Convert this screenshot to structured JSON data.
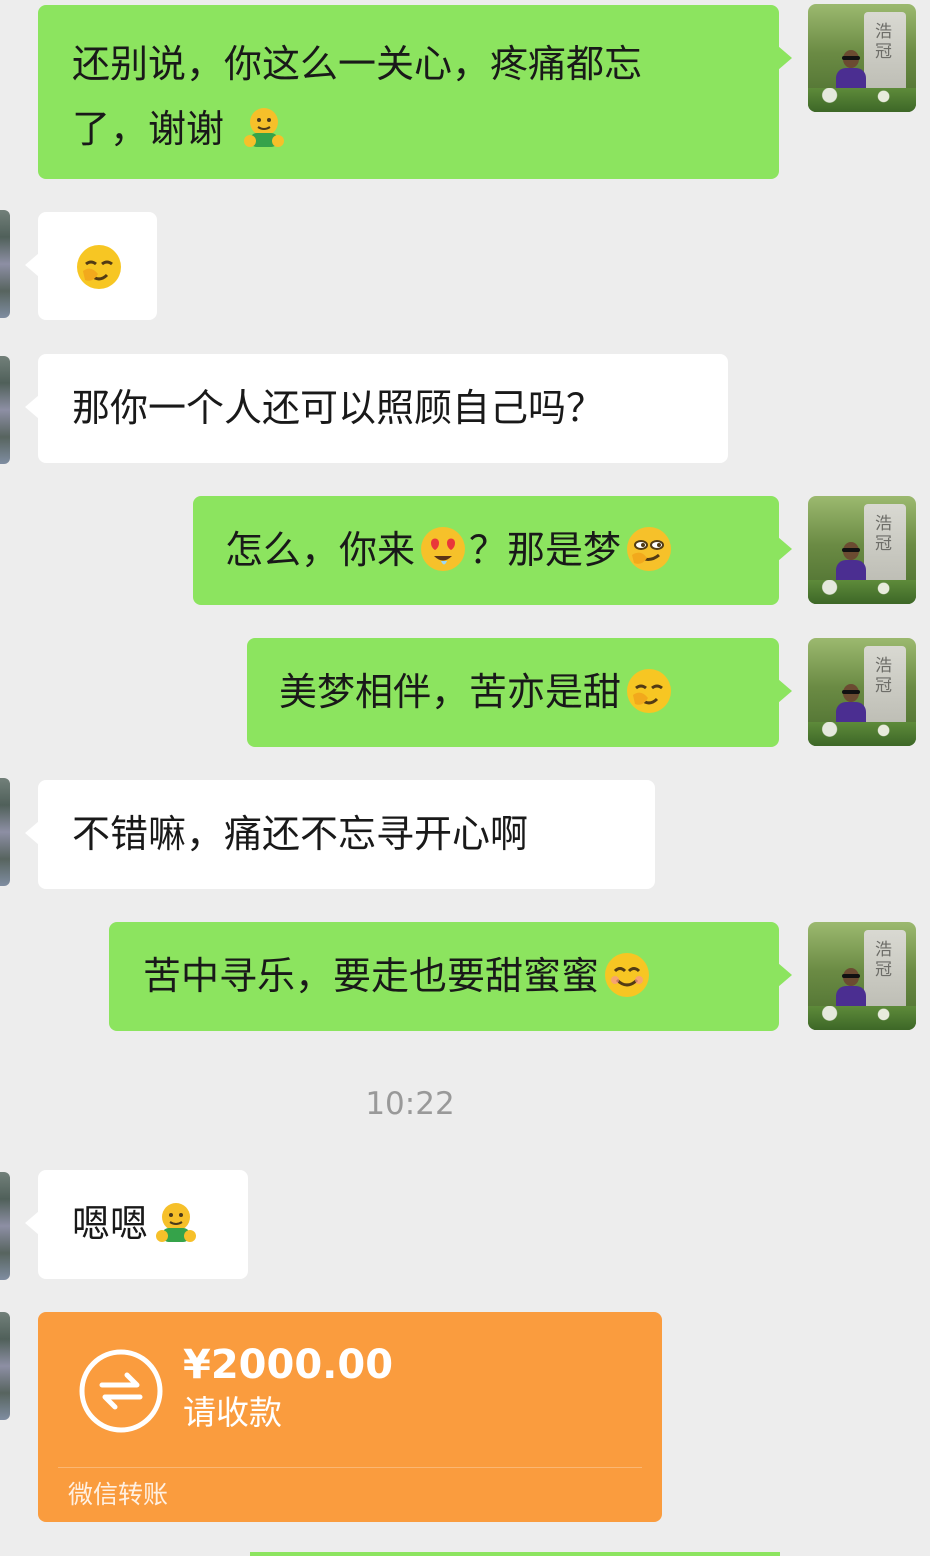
{
  "chat": {
    "messages": [
      {
        "id": "m1",
        "side": "right",
        "text_line1": "还别说，你这么一关心，疼痛都忘",
        "text_line2": "了，谢谢",
        "emoji": "hug-emoji"
      },
      {
        "id": "m2",
        "side": "left",
        "emoji": "giggle-emoji"
      },
      {
        "id": "m3",
        "side": "left",
        "text": "那你一个人还可以照顾自己吗？"
      },
      {
        "id": "m4",
        "side": "right",
        "text_before": "怎么，你来",
        "emoji1": "heart-eyes-emoji",
        "text_after": "？那是梦",
        "emoji2": "smirk-emoji"
      },
      {
        "id": "m5",
        "side": "right",
        "text": "美梦相伴，苦亦是甜",
        "emoji": "giggle-emoji"
      },
      {
        "id": "m6",
        "side": "left",
        "text": "不错嘛，痛还不忘寻开心啊"
      },
      {
        "id": "m7",
        "side": "right",
        "text": "苦中寻乐，要走也要甜蜜蜜",
        "emoji": "smile-emoji"
      },
      {
        "id": "m8",
        "side": "left",
        "text": "嗯嗯",
        "emoji": "hug-emoji"
      }
    ],
    "timestamp": "10:22",
    "transfer": {
      "amount": "¥2000.00",
      "status": "请收款",
      "footer": "微信转账",
      "icon": "transfer-icon"
    }
  },
  "avatar": {
    "stone_text": "浩\n冠",
    "semantic": "profile-photo"
  },
  "colors": {
    "background": "#ededed",
    "green_bubble": "#8ce45f",
    "white_bubble": "#ffffff",
    "transfer": "#fa9c3e",
    "time": "#999999"
  }
}
